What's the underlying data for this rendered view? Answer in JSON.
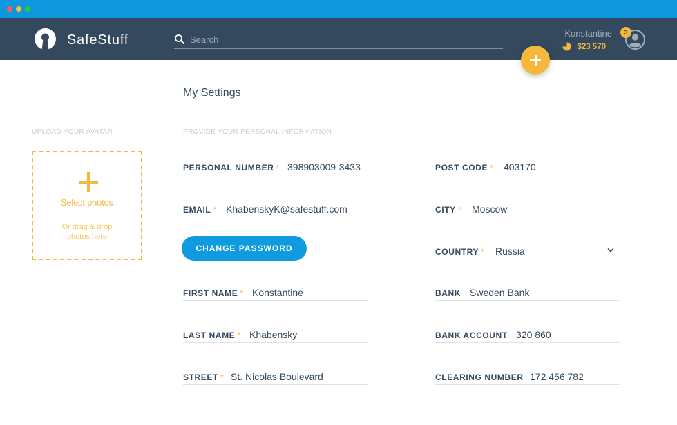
{
  "window": {
    "controls": [
      "close",
      "minimize",
      "maximize"
    ]
  },
  "header": {
    "brand": "SafeStuff",
    "logo_icon": "keyhole-logo-icon",
    "search": {
      "placeholder": "Search",
      "icon": "search-icon"
    },
    "user": {
      "name": "Konstantine",
      "balance": "$23 570",
      "notifications": "3",
      "avatar_icon": "user-avatar-icon",
      "coin_icon": "coin-icon"
    },
    "fab_icon": "plus-icon"
  },
  "page": {
    "title": "My Settings",
    "avatar_section_label": "UPLOAD YOUR AVATAR",
    "info_section_label": "PROVIDE YOUR PERSONAL INFORMATION"
  },
  "upload": {
    "icon": "plus-icon",
    "title": "Select photos",
    "subtitle_line1": "Or drag & drop",
    "subtitle_line2": "photos here"
  },
  "form": {
    "left": [
      {
        "label": "PERSONAL NUMBER",
        "required": true,
        "value": "398903009-3433"
      },
      {
        "label": "EMAIL",
        "required": true,
        "value": "KhabenskyK@safestuff.com"
      },
      {
        "label": "FIRST NAME",
        "required": true,
        "value": "Konstantine"
      },
      {
        "label": "LAST NAME",
        "required": true,
        "value": "Khabensky"
      },
      {
        "label": "STREET",
        "required": true,
        "value": "St. Nicolas Boulevard"
      }
    ],
    "right": [
      {
        "label": "POST CODE",
        "required": true,
        "value": "403170"
      },
      {
        "label": "CITY",
        "required": true,
        "value": "Moscow"
      },
      {
        "label": "COUNTRY",
        "required": true,
        "value": "Russia",
        "type": "select"
      },
      {
        "label": "BANK",
        "required": false,
        "value": "Sweden Bank"
      },
      {
        "label": "BANK ACCOUNT",
        "required": false,
        "value": "320 860"
      },
      {
        "label": "CLEARING NUMBER",
        "required": false,
        "value": "172 456 782"
      }
    ],
    "required_marker": "*",
    "change_password_label": "CHANGE PASSWORD"
  },
  "colors": {
    "accent": "#f6b83b",
    "primary": "#0e9be0",
    "header_bg": "#34495e",
    "titlebar": "#0e97dc"
  }
}
